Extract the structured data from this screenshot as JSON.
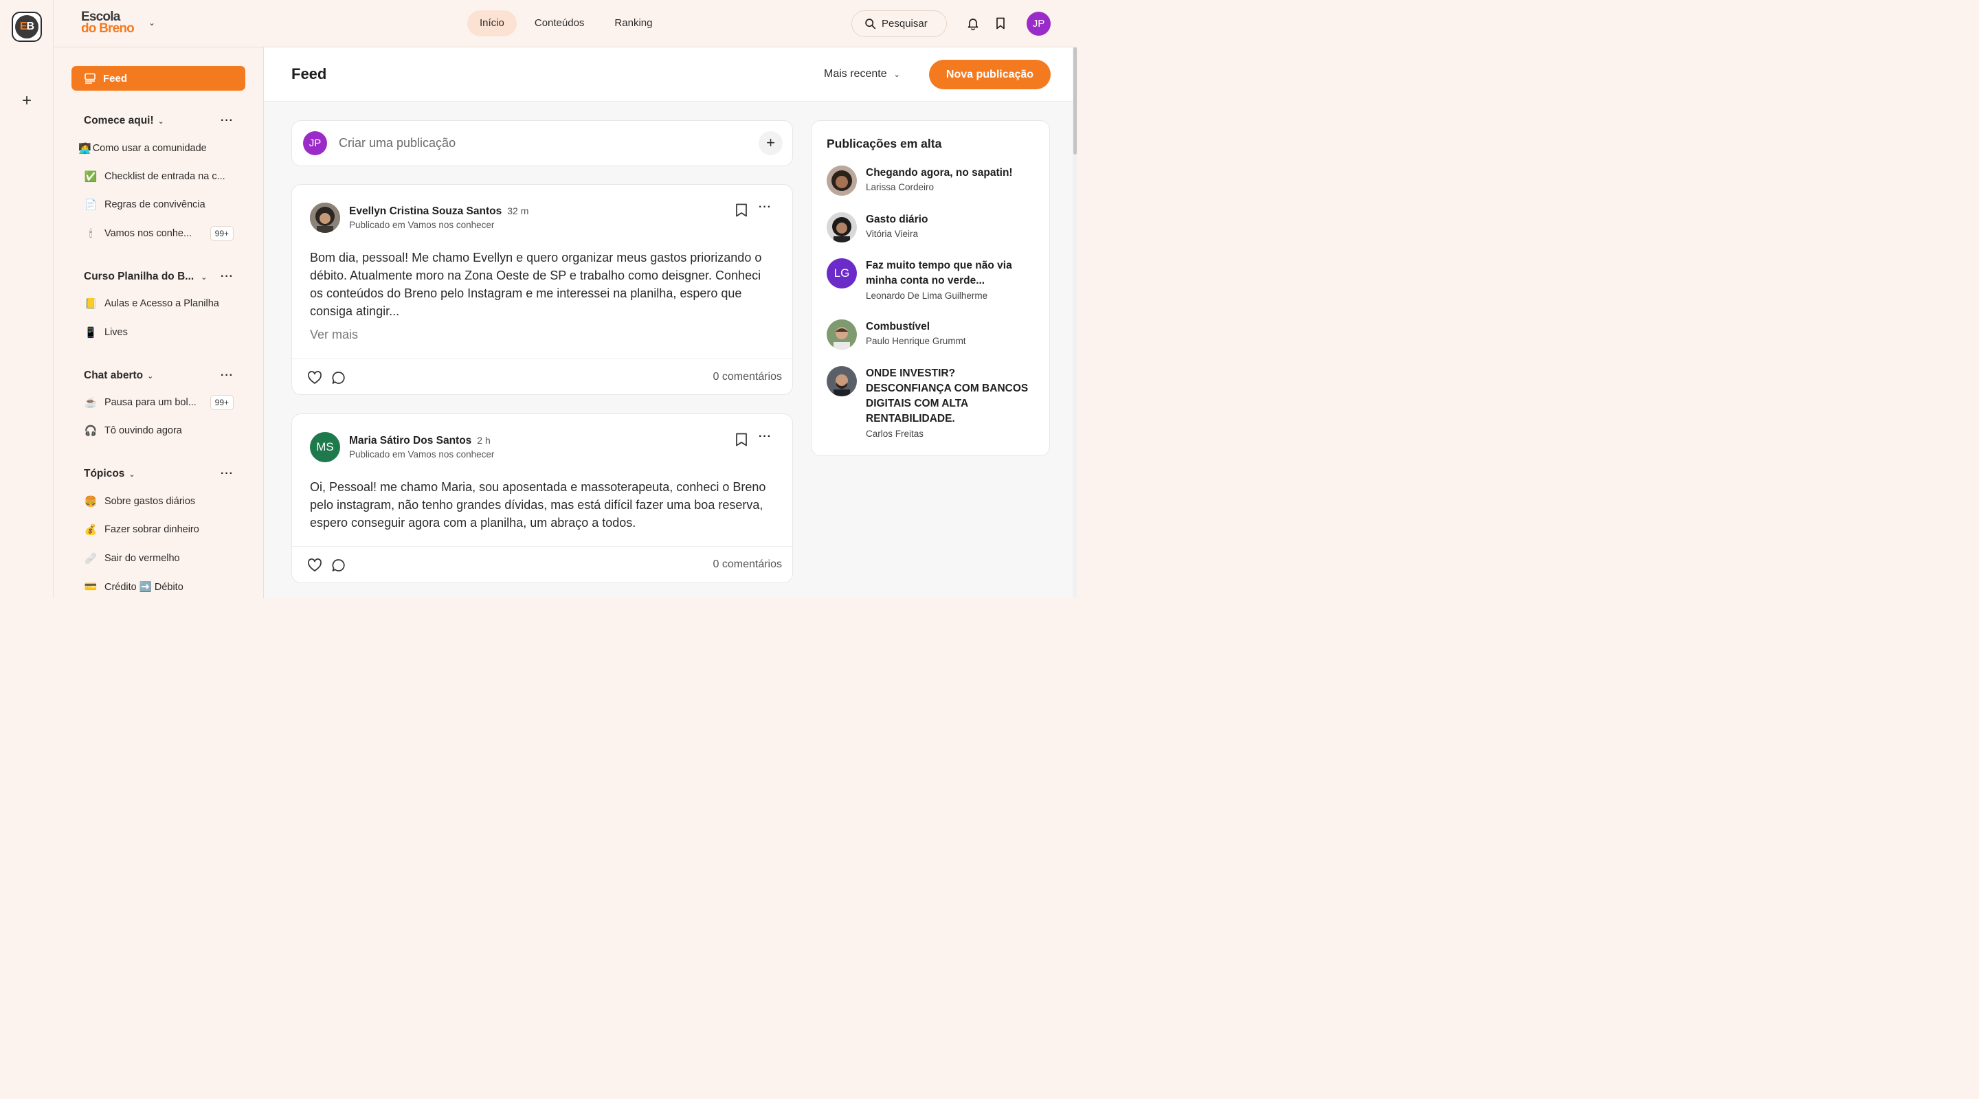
{
  "brand": {
    "line1": "Escola",
    "line2": "do Breno",
    "rail_logo_left": "E",
    "rail_logo_right": "B"
  },
  "nav": {
    "items": [
      {
        "label": "Início",
        "active": true
      },
      {
        "label": "Conteúdos",
        "active": false
      },
      {
        "label": "Ranking",
        "active": false
      }
    ]
  },
  "search": {
    "label": "Pesquisar"
  },
  "user": {
    "initials": "JP",
    "color": "#9b2bc8"
  },
  "sidebar": {
    "feed_label": "Feed",
    "sections": [
      {
        "title": "Comece aqui!",
        "items": [
          {
            "icon": "🧑‍💻",
            "label": "Como usar a comunidade"
          },
          {
            "icon": "✅",
            "label": "Checklist de entrada na c..."
          },
          {
            "icon": "📄",
            "label": "Regras de convivência"
          },
          {
            "icon": "🕯",
            "label": "Vamos nos conhe...",
            "badge": "99+"
          }
        ]
      },
      {
        "title": "Curso Planilha do B...",
        "items": [
          {
            "icon": "📒",
            "label": "Aulas e Acesso a Planilha"
          },
          {
            "icon": "📱",
            "label": "Lives"
          }
        ]
      },
      {
        "title": "Chat aberto",
        "items": [
          {
            "icon": "☕",
            "label": "Pausa para um bol...",
            "badge": "99+"
          },
          {
            "icon": "🎧",
            "label": "Tô ouvindo agora"
          }
        ]
      },
      {
        "title": "Tópicos",
        "items": [
          {
            "icon": "🍔",
            "label": "Sobre gastos diários"
          },
          {
            "icon": "💰",
            "label": "Fazer sobrar dinheiro"
          },
          {
            "icon": "🩹",
            "label": "Sair do vermelho"
          },
          {
            "icon": "💳",
            "label": "Crédito ➡️ Débito"
          }
        ]
      }
    ]
  },
  "main": {
    "title": "Feed",
    "sort_label": "Mais recente",
    "new_post_label": "Nova publicação"
  },
  "composer": {
    "placeholder": "Criar uma publicação",
    "initials": "JP"
  },
  "posts": [
    {
      "author": "Evellyn Cristina Souza Santos",
      "time": "32 m",
      "where": "Publicado em Vamos nos conhecer",
      "body": "Bom dia, pessoal! Me chamo Evellyn e quero organizar meus gastos priorizando o débito.  Atualmente moro na Zona Oeste de SP e trabalho como deisgner. Conheci os conteúdos do Breno pelo Instagram e me interessei na planilha, espero que consiga atingir...",
      "see_more": "Ver mais",
      "comments": "0 comentários"
    },
    {
      "author": "Maria Sátiro Dos Santos",
      "time": "2 h",
      "where": "Publicado em Vamos nos conhecer",
      "initials": "MS",
      "avatar_color": "#1e7a4c",
      "body": "Oi, Pessoal! me chamo Maria, sou aposentada e massoterapeuta, conheci o Breno pelo instagram, não tenho grandes dívidas, mas está difícil fazer uma boa reserva, espero conseguir agora com a planilha, um abraço a todos.",
      "comments": "0 comentários"
    }
  ],
  "trending": {
    "title": "Publicações em alta",
    "items": [
      {
        "title": "Chegando agora, no sapatin!",
        "author": "Larissa Cordeiro"
      },
      {
        "title": "Gasto diário",
        "author": "Vitória Vieira"
      },
      {
        "title": "Faz muito tempo que não via minha conta no verde...",
        "author": "Leonardo De Lima Guilherme",
        "initials": "LG",
        "avatar_color": "#6a2bc8"
      },
      {
        "title": "Combustível",
        "author": "Paulo Henrique Grummt"
      },
      {
        "title": "ONDE INVESTIR? DESCONFIANÇA COM BANCOS DIGITAIS COM ALTA RENTABILIDADE.",
        "author": "Carlos Freitas"
      }
    ]
  },
  "colors": {
    "accent": "#f47a20",
    "background": "#fdf3ee"
  }
}
